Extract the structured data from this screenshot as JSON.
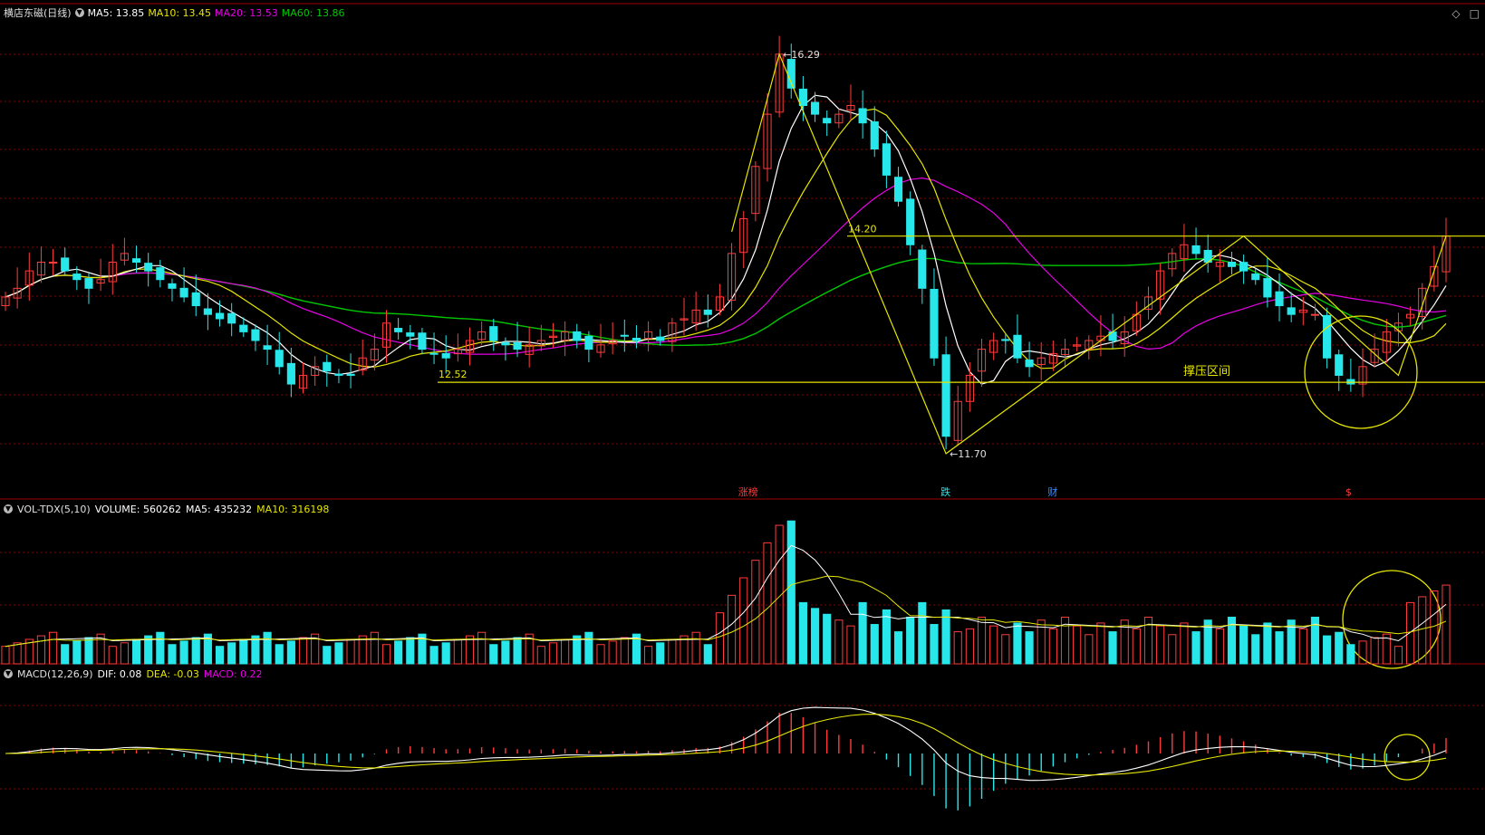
{
  "colors": {
    "up": "#ff3c3c",
    "down": "#27e7ea",
    "ma5": "#ffffff",
    "ma10": "#e6e600",
    "ma20": "#e600e6",
    "ma60": "#00c800",
    "grid": "#8b0000",
    "annot": "#e6e600"
  },
  "main": {
    "title": "横店东磁(日线)",
    "legend": [
      {
        "text": "MA5: 13.85",
        "color": "#ffffff"
      },
      {
        "text": "MA10: 13.45",
        "color": "#e6e600"
      },
      {
        "text": "MA20: 13.53",
        "color": "#e600e6"
      },
      {
        "text": "MA60: 13.86",
        "color": "#00c800"
      }
    ],
    "annotations": {
      "high": "16.29",
      "low": "11.70",
      "resistance": "14.20",
      "support": "12.52",
      "zone": "撑压区间"
    },
    "markers": [
      {
        "text": "涨榜",
        "color": "#ff3c3c",
        "i": 62
      },
      {
        "text": "跌",
        "color": "#27e7ea",
        "i": 79
      },
      {
        "text": "财",
        "color": "#3a8cff",
        "i": 88
      },
      {
        "text": "$",
        "color": "#ff3c3c",
        "i": 113
      }
    ]
  },
  "vol": {
    "title": "VOL-TDX(5,10)",
    "legend": [
      {
        "text": "VOLUME: 560262",
        "color": "#ffffff"
      },
      {
        "text": "MA5: 435232",
        "color": "#ffffff"
      },
      {
        "text": "MA10: 316198",
        "color": "#e6e600"
      }
    ]
  },
  "macd": {
    "title": "MACD(12,26,9)",
    "legend": [
      {
        "text": "DIF: 0.08",
        "color": "#ffffff"
      },
      {
        "text": "DEA: -0.03",
        "color": "#e6e600"
      },
      {
        "text": "MACD: 0.22",
        "color": "#e600e6"
      }
    ]
  },
  "chart_data": {
    "type": "candlestick",
    "symbol": "横店东磁",
    "candle_count": 122,
    "price_range": [
      11.2,
      16.6
    ],
    "closes": [
      13.5,
      13.6,
      13.8,
      13.9,
      13.9,
      13.8,
      13.7,
      13.6,
      13.7,
      13.9,
      14.0,
      13.9,
      13.8,
      13.7,
      13.6,
      13.5,
      13.4,
      13.3,
      13.25,
      13.2,
      13.1,
      13.0,
      12.9,
      12.7,
      12.5,
      12.6,
      12.7,
      12.65,
      12.6,
      12.6,
      12.8,
      12.9,
      13.2,
      13.1,
      13.05,
      12.9,
      12.85,
      12.8,
      12.9,
      13.0,
      13.1,
      13.0,
      12.95,
      12.9,
      12.95,
      13.0,
      13.05,
      13.1,
      13.0,
      12.9,
      12.95,
      13.0,
      13.05,
      13.0,
      13.1,
      13.0,
      13.2,
      13.25,
      13.35,
      13.3,
      13.5,
      14.0,
      14.4,
      15.0,
      15.6,
      16.29,
      15.9,
      15.7,
      15.6,
      15.5,
      15.6,
      15.7,
      15.5,
      15.2,
      14.9,
      14.6,
      14.1,
      13.6,
      12.8,
      11.9,
      12.3,
      12.6,
      12.9,
      13.0,
      13.0,
      12.8,
      12.7,
      12.8,
      12.85,
      12.9,
      12.95,
      13.0,
      13.05,
      13.0,
      13.1,
      13.3,
      13.5,
      13.8,
      14.0,
      14.1,
      14.0,
      13.9,
      13.9,
      13.85,
      13.8,
      13.7,
      13.5,
      13.4,
      13.3,
      13.35,
      13.3,
      12.8,
      12.6,
      12.5,
      12.7,
      12.9,
      13.1,
      13.2,
      13.3,
      13.6,
      13.85,
      14.2
    ],
    "ma60_note": "MA60 smooth line",
    "volume_note": "daily volume bars with MA5 / MA10",
    "macd_note": "DIF, DEA lines with MACD histogram"
  }
}
